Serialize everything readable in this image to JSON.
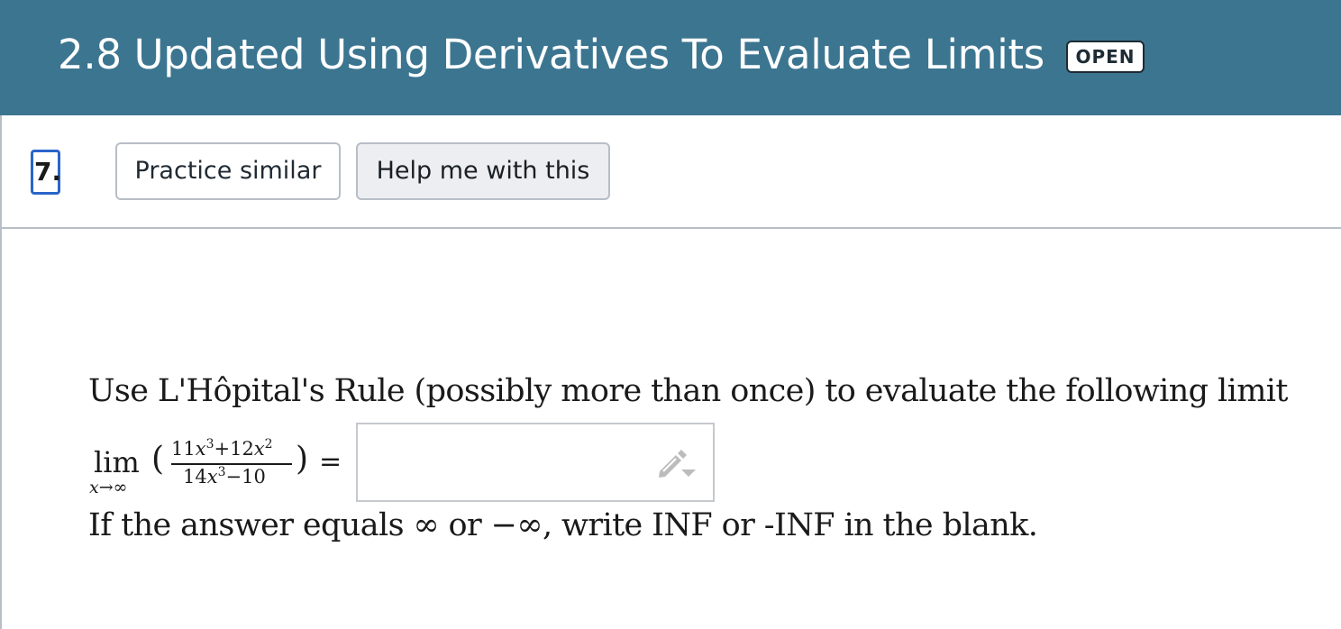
{
  "header": {
    "title": "2.8 Updated Using Derivatives To Evaluate Limits",
    "status_badge": "OPEN",
    "background_color": "#3c7590"
  },
  "question": {
    "number": "7.",
    "buttons": {
      "practice_similar": "Practice similar",
      "help_me": "Help me with this"
    },
    "prompt": "Use L'Hôpital's Rule (possibly more than once) to evaluate the following limit",
    "math": {
      "lim": "lim",
      "lim_sub": "x→∞",
      "open_paren": "(",
      "close_paren": ")",
      "numerator": {
        "c1": "11",
        "v1": "x",
        "e1": "3",
        "op": "+12",
        "v2": "x",
        "e2": "2"
      },
      "denominator": {
        "c1": "14",
        "v1": "x",
        "e1": "3",
        "rest": "−10"
      },
      "equals": "="
    },
    "answer": {
      "value": "",
      "icon": "pencil-icon"
    },
    "note": "If the answer equals ∞ or −∞, write INF or -INF in the blank."
  }
}
